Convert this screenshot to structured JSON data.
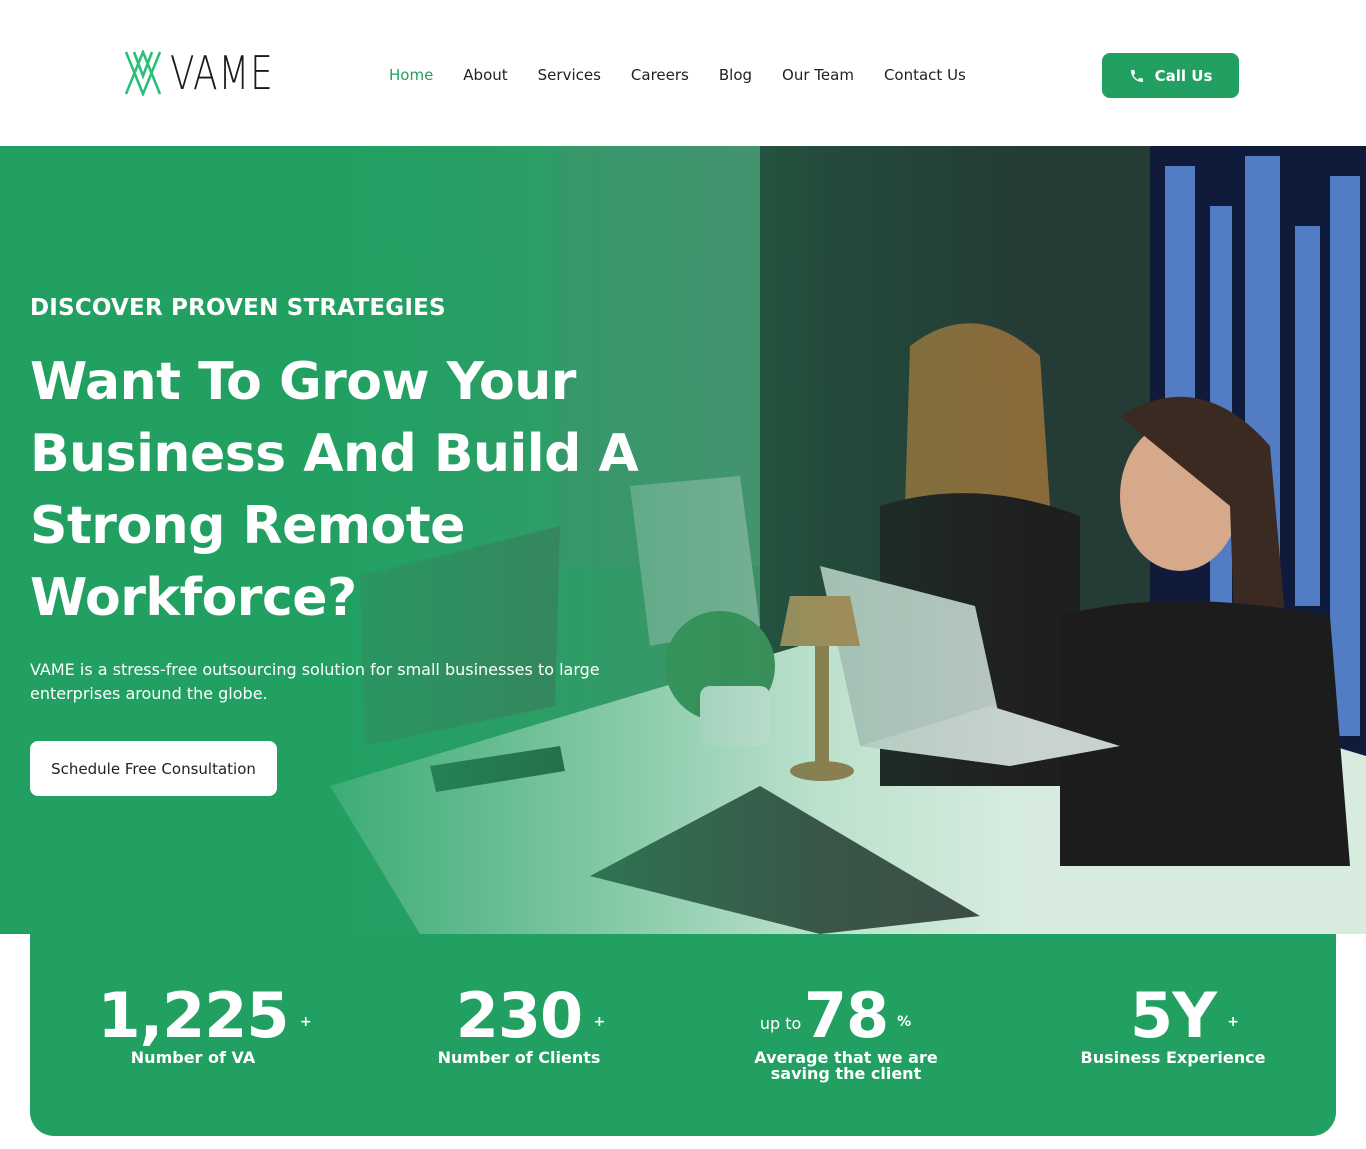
{
  "brand": {
    "name": "VAME"
  },
  "nav": {
    "items": [
      {
        "label": "Home",
        "active": true
      },
      {
        "label": "About"
      },
      {
        "label": "Services"
      },
      {
        "label": "Careers"
      },
      {
        "label": "Blog"
      },
      {
        "label": "Our Team"
      },
      {
        "label": "Contact Us"
      }
    ],
    "call_label": "Call Us"
  },
  "hero": {
    "eyebrow": "DISCOVER PROVEN STRATEGIES",
    "title": "Want To Grow Your Business And Build A Strong Remote Workforce?",
    "description": "VAME is a stress-free outsourcing solution for small businesses to large enterprises around the globe.",
    "cta_label": "Schedule Free Consultation"
  },
  "stats": [
    {
      "prefix": "",
      "value": "1,225",
      "suffix": "+",
      "label": "Number of VA"
    },
    {
      "prefix": "",
      "value": "230",
      "suffix": "+",
      "label": "Number of Clients"
    },
    {
      "prefix": "up to",
      "value": "78",
      "suffix": "%",
      "label": "Average that we are saving the client"
    },
    {
      "prefix": "",
      "value": "5Y",
      "suffix": "+",
      "label": "Business Experience"
    }
  ],
  "colors": {
    "accent": "#21a062",
    "text": "#222222",
    "white": "#ffffff"
  },
  "icons": {
    "call": "phone-icon",
    "logo": "vame-logo-mark-icon"
  }
}
